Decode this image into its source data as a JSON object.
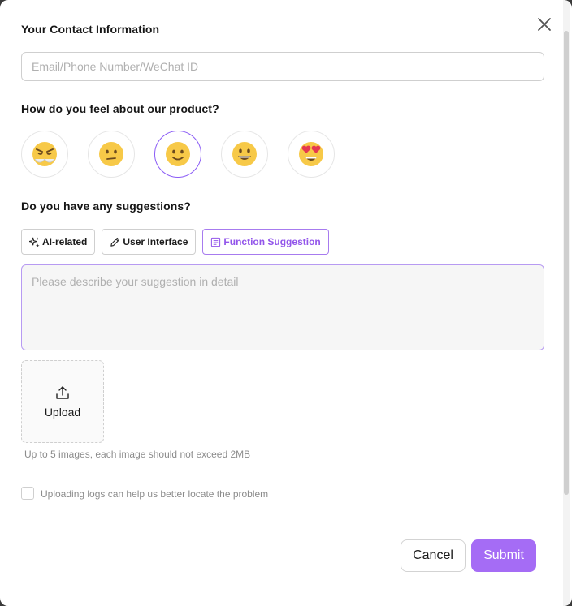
{
  "contact": {
    "title": "Your Contact Information",
    "placeholder": "Email/Phone Number/WeChat ID",
    "value": ""
  },
  "feeling": {
    "title": "How do you feel about our product?",
    "options": [
      {
        "name": "angry-face",
        "selected": false
      },
      {
        "name": "confused-face",
        "selected": false
      },
      {
        "name": "slightly-smiling-face",
        "selected": true
      },
      {
        "name": "grinning-face",
        "selected": false
      },
      {
        "name": "heart-eyes-face",
        "selected": false
      }
    ]
  },
  "suggestions": {
    "title": "Do you have any suggestions?",
    "tags": [
      {
        "label": "AI-related",
        "icon": "sparkles-icon",
        "active": false
      },
      {
        "label": "User Interface",
        "icon": "pencil-icon",
        "active": false
      },
      {
        "label": "Function Suggestion",
        "icon": "document-icon",
        "active": true
      }
    ],
    "placeholder": "Please describe your suggestion in detail",
    "value": ""
  },
  "upload": {
    "label": "Upload",
    "hint": "Up to 5 images, each image should not exceed 2MB"
  },
  "logs": {
    "label": "Uploading logs can help us better locate the problem",
    "checked": false
  },
  "actions": {
    "cancel": "Cancel",
    "submit": "Submit"
  },
  "colors": {
    "accent": "#a56cf5",
    "accent_border": "#b79af2",
    "emoji_yellow": "#f7c948"
  }
}
